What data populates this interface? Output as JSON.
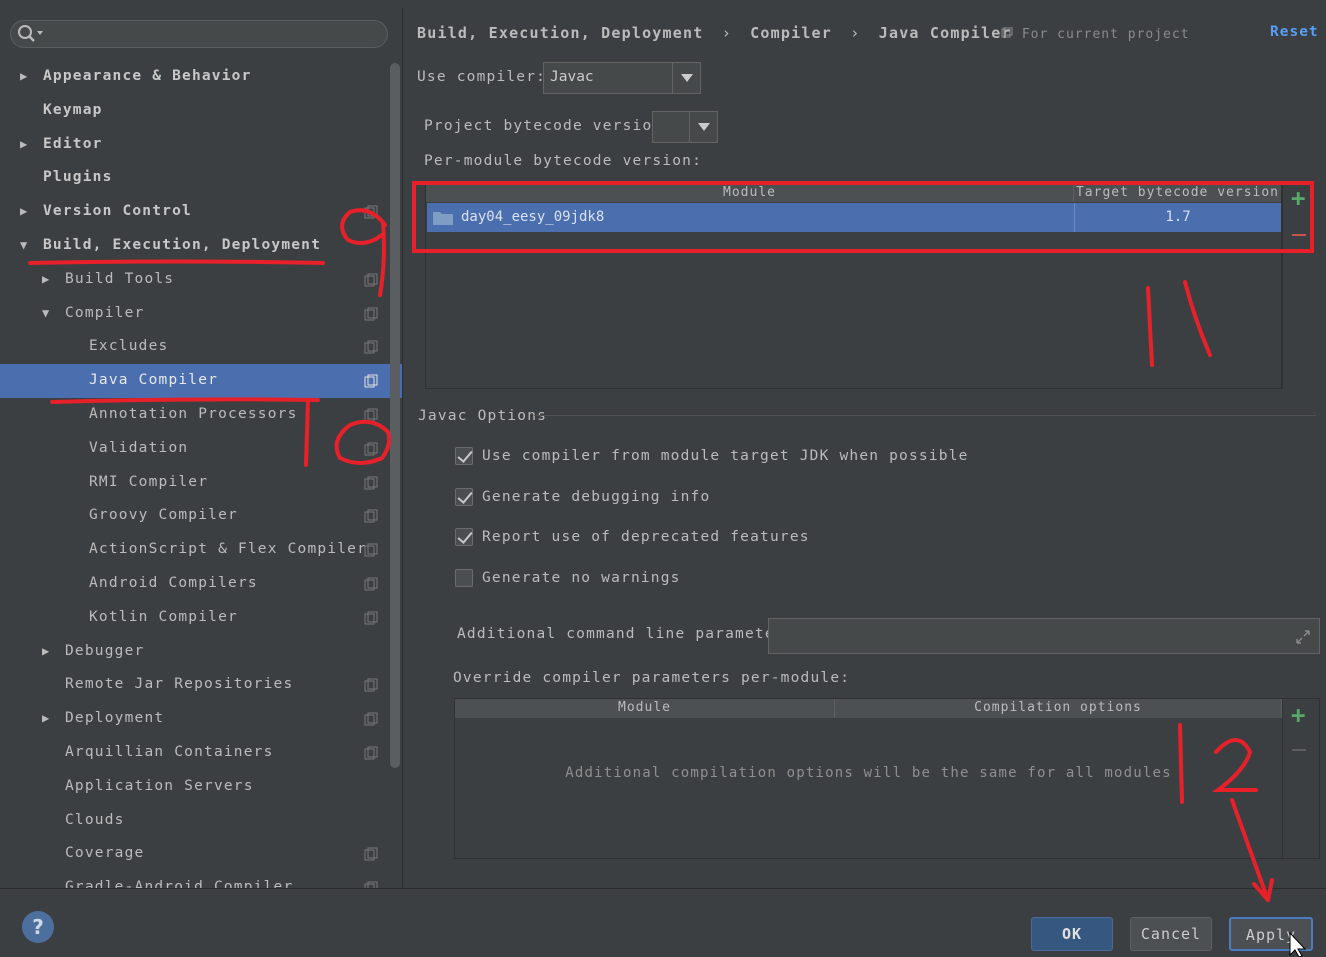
{
  "search": {
    "placeholder": ""
  },
  "sidebar": {
    "items": [
      {
        "label": "Appearance & Behavior",
        "level": 0,
        "arrow": "collapsed",
        "bold": true
      },
      {
        "label": "Keymap",
        "level": 0,
        "arrow": "none",
        "bold": true
      },
      {
        "label": "Editor",
        "level": 0,
        "arrow": "collapsed",
        "bold": true
      },
      {
        "label": "Plugins",
        "level": 0,
        "arrow": "none",
        "bold": true
      },
      {
        "label": "Version Control",
        "level": 0,
        "arrow": "collapsed",
        "bold": true,
        "proj": true
      },
      {
        "label": "Build, Execution, Deployment",
        "level": 0,
        "arrow": "expanded",
        "bold": true
      },
      {
        "label": "Build Tools",
        "level": 1,
        "arrow": "collapsed",
        "proj": true
      },
      {
        "label": "Compiler",
        "level": 1,
        "arrow": "expanded",
        "proj": true
      },
      {
        "label": "Excludes",
        "level": 2,
        "arrow": "none",
        "proj": true
      },
      {
        "label": "Java Compiler",
        "level": 2,
        "arrow": "none",
        "proj": true,
        "selected": true
      },
      {
        "label": "Annotation Processors",
        "level": 2,
        "arrow": "none",
        "proj": true
      },
      {
        "label": "Validation",
        "level": 2,
        "arrow": "none",
        "proj": true
      },
      {
        "label": "RMI Compiler",
        "level": 2,
        "arrow": "none",
        "proj": true
      },
      {
        "label": "Groovy Compiler",
        "level": 2,
        "arrow": "none",
        "proj": true
      },
      {
        "label": "ActionScript & Flex Compiler",
        "level": 2,
        "arrow": "none",
        "proj": true
      },
      {
        "label": "Android Compilers",
        "level": 2,
        "arrow": "none",
        "proj": true
      },
      {
        "label": "Kotlin Compiler",
        "level": 2,
        "arrow": "none",
        "proj": true
      },
      {
        "label": "Debugger",
        "level": 1,
        "arrow": "collapsed"
      },
      {
        "label": "Remote Jar Repositories",
        "level": 1,
        "arrow": "none",
        "proj": true
      },
      {
        "label": "Deployment",
        "level": 1,
        "arrow": "collapsed",
        "proj": true
      },
      {
        "label": "Arquillian Containers",
        "level": 1,
        "arrow": "none",
        "proj": true
      },
      {
        "label": "Application Servers",
        "level": 1,
        "arrow": "none"
      },
      {
        "label": "Clouds",
        "level": 1,
        "arrow": "none"
      },
      {
        "label": "Coverage",
        "level": 1,
        "arrow": "none",
        "proj": true
      },
      {
        "label": "Gradle-Android Compiler",
        "level": 1,
        "arrow": "none",
        "proj": true
      }
    ]
  },
  "header": {
    "crumb1": "Build, Execution, Deployment",
    "crumb2": "Compiler",
    "crumb3": "Java Compiler",
    "sep": "›",
    "scope": "For current project",
    "reset": "Reset"
  },
  "compiler": {
    "use_label": "Use compiler:",
    "use_value": "Javac",
    "project_bytecode_label": "Project bytecode version:",
    "project_bytecode_value": "",
    "per_module_label": "Per-module bytecode version:",
    "table_headers": [
      "Module",
      "Target bytecode version"
    ],
    "rows": [
      {
        "module": "day04_eesy_09jdk8",
        "target": "1.7"
      }
    ]
  },
  "javac": {
    "section_label": "Javac Options",
    "options": [
      {
        "label": "Use compiler from module target JDK when possible",
        "checked": true
      },
      {
        "label": "Generate debugging info",
        "checked": true
      },
      {
        "label": "Report use of deprecated features",
        "checked": true
      },
      {
        "label": "Generate no warnings",
        "checked": false
      }
    ],
    "additional_label": "Additional command line parameters:",
    "additional_value": "",
    "override_label": "Override compiler parameters per-module:",
    "override_headers": [
      "Module",
      "Compilation options"
    ],
    "override_empty": "Additional compilation options will be the same for all modules"
  },
  "buttons": {
    "ok": "OK",
    "cancel": "Cancel",
    "apply": "Apply",
    "help": "?"
  },
  "annotations": {
    "n9": "9",
    "n10": "10",
    "n11": "11",
    "n12": "12"
  },
  "colors": {
    "selection": "#4b6eaf",
    "accent_link": "#589df6",
    "annotation_red": "#e8202a",
    "add_green": "#59a869",
    "remove_red": "#c75450"
  }
}
